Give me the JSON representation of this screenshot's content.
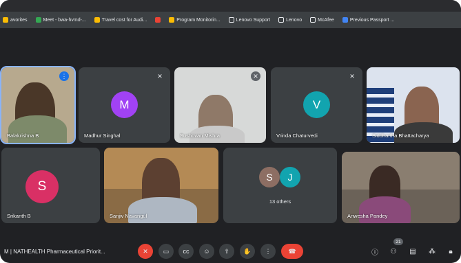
{
  "bookmarks": [
    {
      "label": "avorites",
      "color": "#fbbc04"
    },
    {
      "label": "Meet - bwa-hvmd-...",
      "color": "#34a853"
    },
    {
      "label": "Travel cost for Audi...",
      "color": "#fbbc04"
    },
    {
      "label": "",
      "color": "#ea4335"
    },
    {
      "label": "Program Monitorin...",
      "color": "#fbbc04"
    },
    {
      "label": "Lenovo Support",
      "color": "#e8eaed"
    },
    {
      "label": "Lenovo",
      "color": "#e8eaed"
    },
    {
      "label": "McAfee",
      "color": "#e8eaed"
    },
    {
      "label": "Previous Passport ...",
      "color": "#4285f4"
    }
  ],
  "participants": {
    "p1": {
      "name": "Balakrishna B"
    },
    "p2": {
      "name": "Madhur Singhal",
      "initial": "M",
      "color": "#a142f4"
    },
    "p3": {
      "name": "Sushovan Mishra"
    },
    "p4": {
      "name": "Vrinda Chaturvedi",
      "initial": "V",
      "color": "#12a4af"
    },
    "p5": {
      "name": "Siddhartha Bhattacharya"
    },
    "p6": {
      "name": "Srikanth B",
      "initial": "S",
      "color": "#d93065"
    },
    "p7": {
      "name": "Sanjiv Navangul"
    },
    "others": {
      "initials": [
        "S",
        "J"
      ],
      "colors": [
        "#8d6e63",
        "#12a4af"
      ],
      "label": "13 others"
    },
    "p9": {
      "name": "Anwesha Pandey"
    }
  },
  "meeting": {
    "title": "M  |  NATHEALTH Pharmaceutical Priorit..."
  },
  "controls": {
    "people_count": "21"
  }
}
